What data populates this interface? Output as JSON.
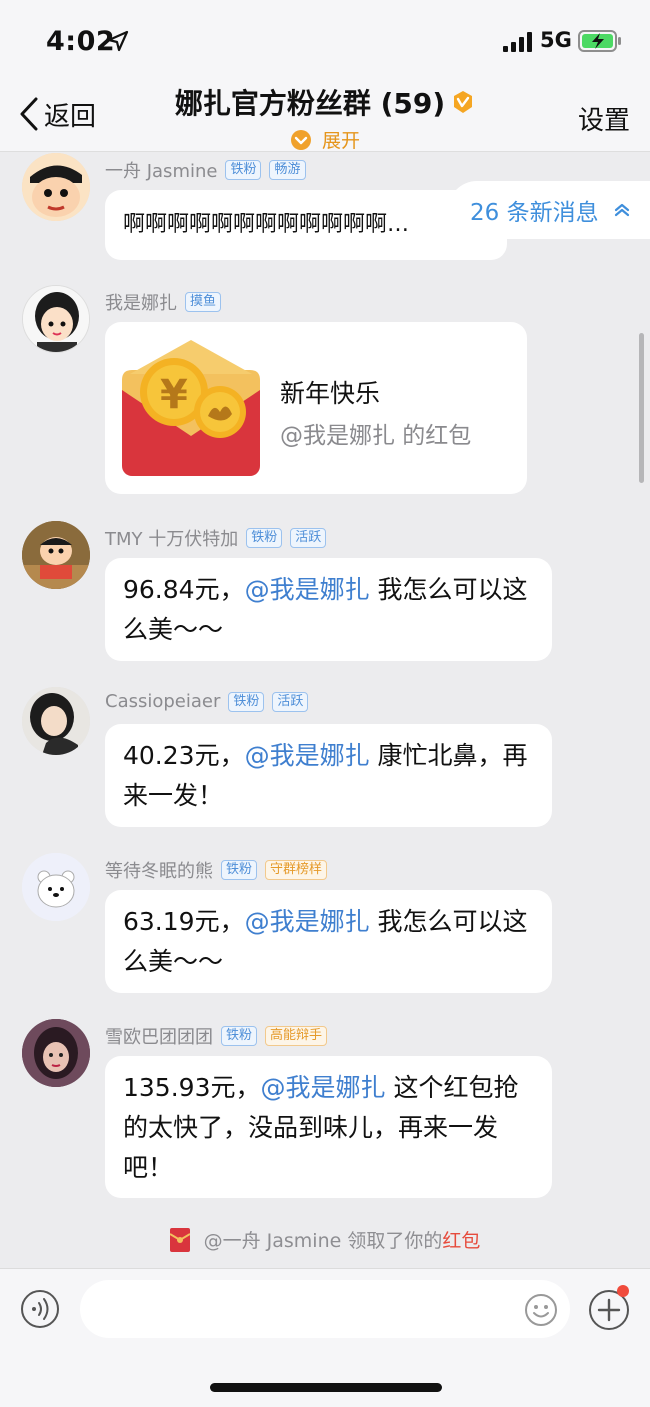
{
  "status_bar": {
    "time": "4:02",
    "network": "5G"
  },
  "header": {
    "back_label": "返回",
    "title": "娜扎官方粉丝群 (59)",
    "expand_label": "展开",
    "settings_label": "设置"
  },
  "new_messages": {
    "label": "26 条新消息"
  },
  "messages": [
    {
      "sender": "一舟 Jasmine",
      "tags": [
        "铁粉",
        "畅游"
      ],
      "text": "啊啊啊啊啊啊啊啊啊啊啊啊…"
    },
    {
      "sender": "我是娜扎",
      "tags": [
        "摸鱼"
      ],
      "packet_title": "新年快乐",
      "packet_sub": "@我是娜扎 的红包"
    },
    {
      "sender": "TMY 十万伏特加",
      "tags": [
        "铁粉",
        "活跃"
      ],
      "amount": "96.84元，",
      "mention": "@我是娜扎",
      "rest": " 我怎么可以这么美～～"
    },
    {
      "sender": "Cassiopeiaer",
      "tags": [
        "铁粉",
        "活跃"
      ],
      "amount": "40.23元，",
      "mention": "@我是娜扎",
      "rest": " 康忙北鼻，再来一发！"
    },
    {
      "sender": "等待冬眠的熊",
      "tags": [
        "铁粉",
        "守群榜样"
      ],
      "amount": "63.19元，",
      "mention": "@我是娜扎",
      "rest": " 我怎么可以这么美～～"
    },
    {
      "sender": "雪欧巴团团团",
      "tags": [
        "铁粉",
        "高能辩手"
      ],
      "amount": "135.93元，",
      "mention": "@我是娜扎",
      "rest": " 这个红包抢的太快了，没品到味儿，再来一发吧！"
    }
  ],
  "notice": {
    "text": "@一舟 Jasmine 领取了你的",
    "link": "红包"
  },
  "colors": {
    "mention": "#3f7fcf",
    "accent_orange": "#e5951b",
    "packet_red": "#d9353d"
  }
}
